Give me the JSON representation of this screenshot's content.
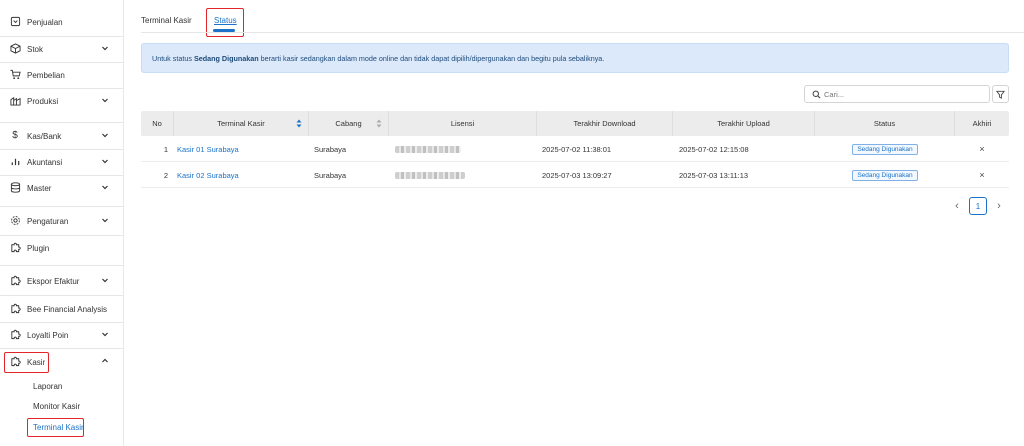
{
  "sidebar": {
    "items": [
      {
        "label": "Penjualan",
        "icon": "receipt-icon"
      },
      {
        "label": "Stok",
        "icon": "box-icon"
      },
      {
        "label": "Pembelian",
        "icon": "cart-icon"
      },
      {
        "label": "Produksi",
        "icon": "factory-icon"
      },
      {
        "label": "Kas/Bank",
        "icon": "dollar-icon"
      },
      {
        "label": "Akuntansi",
        "icon": "bar-chart-icon"
      },
      {
        "label": "Master",
        "icon": "database-icon"
      },
      {
        "label": "Pengaturan",
        "icon": "gear-icon"
      },
      {
        "label": "Plugin",
        "icon": "puzzle-icon"
      },
      {
        "label": "Ekspor Efaktur",
        "icon": "puzzle-icon"
      },
      {
        "label": "Bee Financial Analysis",
        "icon": "puzzle-icon"
      },
      {
        "label": "Loyalti Poin",
        "icon": "puzzle-icon"
      },
      {
        "label": "Kasir",
        "icon": "puzzle-icon"
      }
    ],
    "subitems": [
      "Laporan",
      "Monitor Kasir",
      "Terminal Kasir"
    ]
  },
  "tabs": [
    "Terminal Kasir",
    "Status"
  ],
  "info": {
    "prefix": "Untuk status ",
    "bold": "Sedang Digunakan",
    "suffix": " berarti kasir sedangkan dalam mode online dan tidak dapat dipilih/dipergunakan dan begitu pula sebaliknya."
  },
  "search": {
    "placeholder": "Cari..."
  },
  "table": {
    "headers": [
      "No",
      "Terminal Kasir",
      "Cabang",
      "Lisensi",
      "Terakhir Download",
      "Terakhir Upload",
      "Status",
      "Akhiri"
    ],
    "rows": [
      {
        "no": "1",
        "terminal": "Kasir 01 Surabaya",
        "cabang": "Surabaya",
        "download": "2025-07-02 11:38:01",
        "upload": "2025-07-02 12:15:08",
        "status": "Sedang Digunakan",
        "akhiri": "×"
      },
      {
        "no": "2",
        "terminal": "Kasir 02 Surabaya",
        "cabang": "Surabaya",
        "download": "2025-07-03 13:09:27",
        "upload": "2025-07-03 13:11:13",
        "status": "Sedang Digunakan",
        "akhiri": "×"
      }
    ]
  },
  "pagination": {
    "page": "1",
    "prev": "‹",
    "next": "›"
  },
  "colors": {
    "accent": "#1a73c8",
    "highlight": "#e0262b",
    "info_bg": "#dbe9fb"
  }
}
